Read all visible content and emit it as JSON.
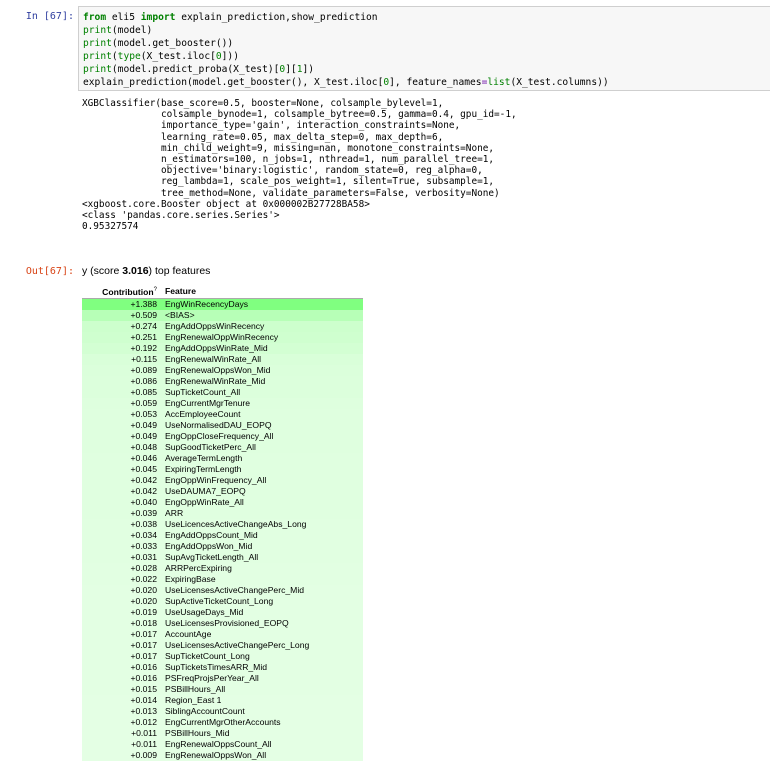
{
  "in_prompt": "In [67]:",
  "out_prompt": "Out[67]:",
  "code_lines": [
    [
      [
        "kw",
        "from"
      ],
      [
        "nm",
        " eli5 "
      ],
      [
        "kw",
        "import"
      ],
      [
        "nm",
        " explain_prediction,show_prediction"
      ]
    ],
    [
      [
        "bi",
        "print"
      ],
      [
        "nm",
        "(model)"
      ]
    ],
    [
      [
        "bi",
        "print"
      ],
      [
        "nm",
        "(model.get_booster())"
      ]
    ],
    [
      [
        "bi",
        "print"
      ],
      [
        "nm",
        "("
      ],
      [
        "bi",
        "type"
      ],
      [
        "nm",
        "(X_test.iloc["
      ],
      [
        "num",
        "0"
      ],
      [
        "nm",
        "]))"
      ]
    ],
    [
      [
        "bi",
        "print"
      ],
      [
        "nm",
        "(model.predict_proba(X_test)["
      ],
      [
        "num",
        "0"
      ],
      [
        "nm",
        "]["
      ],
      [
        "num",
        "1"
      ],
      [
        "nm",
        "])"
      ]
    ],
    [
      [
        "nm",
        "explain_prediction(model.get_booster(), X_test.iloc["
      ],
      [
        "num",
        "0"
      ],
      [
        "nm",
        "], feature_names"
      ],
      [
        "op",
        "="
      ],
      [
        "bi",
        "list"
      ],
      [
        "nm",
        "(X_test.columns))"
      ]
    ]
  ],
  "stdout_lines": [
    "XGBClassifier(base_score=0.5, booster=None, colsample_bylevel=1,",
    "              colsample_bynode=1, colsample_bytree=0.5, gamma=0.4, gpu_id=-1,",
    "              importance_type='gain', interaction_constraints=None,",
    "              learning_rate=0.05, max_delta_step=0, max_depth=6,",
    "              min_child_weight=9, missing=nan, monotone_constraints=None,",
    "              n_estimators=100, n_jobs=1, nthread=1, num_parallel_tree=1,",
    "              objective='binary:logistic', random_state=0, reg_alpha=0,",
    "              reg_lambda=1, scale_pos_weight=1, silent=True, subsample=1,",
    "              tree_method=None, validate_parameters=False, verbosity=None)",
    "<xgboost.core.Booster object at 0x000002B27728BA58>",
    "<class 'pandas.core.series.Series'>",
    "0.95327574"
  ],
  "explanation": {
    "title_prefix": "y (score ",
    "score": "3.016",
    "title_suffix": ") top features",
    "col_contribution": "Contribution",
    "col_contribution_sup": "?",
    "col_feature": "Feature",
    "rows": [
      {
        "value": "+1.388",
        "feature": "EngWinRecencyDays",
        "color": "#80ff80"
      },
      {
        "value": "+0.509",
        "feature": "<BIAS>",
        "color": "#b7ffb7"
      },
      {
        "value": "+0.274",
        "feature": "EngAddOppsWinRecency",
        "color": "#cdffcd"
      },
      {
        "value": "+0.251",
        "feature": "EngRenewalOppWinRecency",
        "color": "#cfffcf"
      },
      {
        "value": "+0.192",
        "feature": "EngAddOppsWinRate_Mid",
        "color": "#d3ffd3"
      },
      {
        "value": "+0.115",
        "feature": "EngRenewalWinRate_All",
        "color": "#d9ffd9"
      },
      {
        "value": "+0.089",
        "feature": "EngRenewalOppsWon_Mid",
        "color": "#dbffdb"
      },
      {
        "value": "+0.086",
        "feature": "EngRenewalWinRate_Mid",
        "color": "#dcffdc"
      },
      {
        "value": "+0.085",
        "feature": "SupTicketCount_All",
        "color": "#dcffdc"
      },
      {
        "value": "+0.059",
        "feature": "EngCurrentMgrTenure",
        "color": "#deffde"
      },
      {
        "value": "+0.053",
        "feature": "AccEmployeeCount",
        "color": "#dfffdf"
      },
      {
        "value": "+0.049",
        "feature": "UseNormalisedDAU_EOPQ",
        "color": "#dfffdf"
      },
      {
        "value": "+0.049",
        "feature": "EngOppCloseFrequency_All",
        "color": "#dfffdf"
      },
      {
        "value": "+0.048",
        "feature": "SupGoodTicketPerc_All",
        "color": "#dfffdf"
      },
      {
        "value": "+0.046",
        "feature": "AverageTermLength",
        "color": "#e0ffe0"
      },
      {
        "value": "+0.045",
        "feature": "ExpiringTermLength",
        "color": "#e0ffe0"
      },
      {
        "value": "+0.042",
        "feature": "EngOppWinFrequency_All",
        "color": "#e0ffe0"
      },
      {
        "value": "+0.042",
        "feature": "UseDAUMA7_EOPQ",
        "color": "#e0ffe0"
      },
      {
        "value": "+0.040",
        "feature": "EngOppWinRate_All",
        "color": "#e0ffe0"
      },
      {
        "value": "+0.039",
        "feature": "ARR",
        "color": "#e0ffe0"
      },
      {
        "value": "+0.038",
        "feature": "UseLicencesActiveChangeAbs_Long",
        "color": "#e1ffe1"
      },
      {
        "value": "+0.034",
        "feature": "EngAddOppsCount_Mid",
        "color": "#e1ffe1"
      },
      {
        "value": "+0.033",
        "feature": "EngAddOppsWon_Mid",
        "color": "#e1ffe1"
      },
      {
        "value": "+0.031",
        "feature": "SupAvgTicketLength_All",
        "color": "#e1ffe1"
      },
      {
        "value": "+0.028",
        "feature": "ARRPercExpiring",
        "color": "#e2ffe2"
      },
      {
        "value": "+0.022",
        "feature": "ExpiringBase",
        "color": "#e2ffe2"
      },
      {
        "value": "+0.020",
        "feature": "UseLicensesActiveChangePerc_Mid",
        "color": "#e3ffe3"
      },
      {
        "value": "+0.020",
        "feature": "SupActiveTicketCount_Long",
        "color": "#e3ffe3"
      },
      {
        "value": "+0.019",
        "feature": "UseUsageDays_Mid",
        "color": "#e3ffe3"
      },
      {
        "value": "+0.018",
        "feature": "UseLicensesProvisioned_EOPQ",
        "color": "#e3ffe3"
      },
      {
        "value": "+0.017",
        "feature": "AccountAge",
        "color": "#e3ffe3"
      },
      {
        "value": "+0.017",
        "feature": "UseLicensesActiveChangePerc_Long",
        "color": "#e3ffe3"
      },
      {
        "value": "+0.017",
        "feature": "SupTicketCount_Long",
        "color": "#e3ffe3"
      },
      {
        "value": "+0.016",
        "feature": "SupTicketsTimesARR_Mid",
        "color": "#e3ffe3"
      },
      {
        "value": "+0.016",
        "feature": "PSFreqProjsPerYear_All",
        "color": "#e3ffe3"
      },
      {
        "value": "+0.015",
        "feature": "PSBillHours_All",
        "color": "#e3ffe3"
      },
      {
        "value": "+0.014",
        "feature": "Region_East 1",
        "color": "#e4ffe4"
      },
      {
        "value": "+0.013",
        "feature": "SiblingAccountCount",
        "color": "#e4ffe4"
      },
      {
        "value": "+0.012",
        "feature": "EngCurrentMgrOtherAccounts",
        "color": "#e4ffe4"
      },
      {
        "value": "+0.011",
        "feature": "PSBillHours_Mid",
        "color": "#e4ffe4"
      },
      {
        "value": "+0.011",
        "feature": "EngRenewalOppsCount_All",
        "color": "#e4ffe4"
      },
      {
        "value": "+0.009",
        "feature": "EngRenewalOppsWon_All",
        "color": "#e4ffe4"
      }
    ]
  }
}
